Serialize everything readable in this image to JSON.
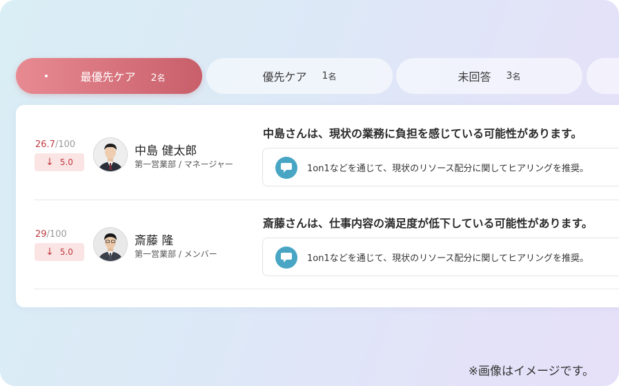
{
  "tabs": [
    {
      "label": "最優先ケア",
      "count": "2",
      "unit": "名",
      "active": true
    },
    {
      "label": "優先ケア",
      "count": "1",
      "unit": "名",
      "active": false
    },
    {
      "label": "未回答",
      "count": "3",
      "unit": "名",
      "active": false
    }
  ],
  "employees": [
    {
      "score": "26.7",
      "score_max": "/100",
      "change": "5.0",
      "change_direction": "down",
      "name": "中島 健太郎",
      "role": "第一営業部 / マネージャー",
      "headline": "中島さんは、現状の業務に負担を感じている可能性があります。",
      "advice": "1on1などを通じて、現状のリソース配分に関してヒアリングを推奨。",
      "advice_icon": "chat-bubble-icon"
    },
    {
      "score": "29",
      "score_max": "/100",
      "change": "5.0",
      "change_direction": "down",
      "name": "斎藤 隆",
      "role": "第一営業部 / メンバー",
      "headline": "斎藤さんは、仕事内容の満足度が低下している可能性があります。",
      "advice": "1on1などを通じて、現状のリソース配分に関してヒアリングを推奨。",
      "advice_icon": "chat-bubble-icon"
    }
  ],
  "footnote": "※画像はイメージです。",
  "colors": {
    "accent": "#c85f6a",
    "score_red": "#c0393f",
    "chat_icon": "#48a6c4"
  }
}
